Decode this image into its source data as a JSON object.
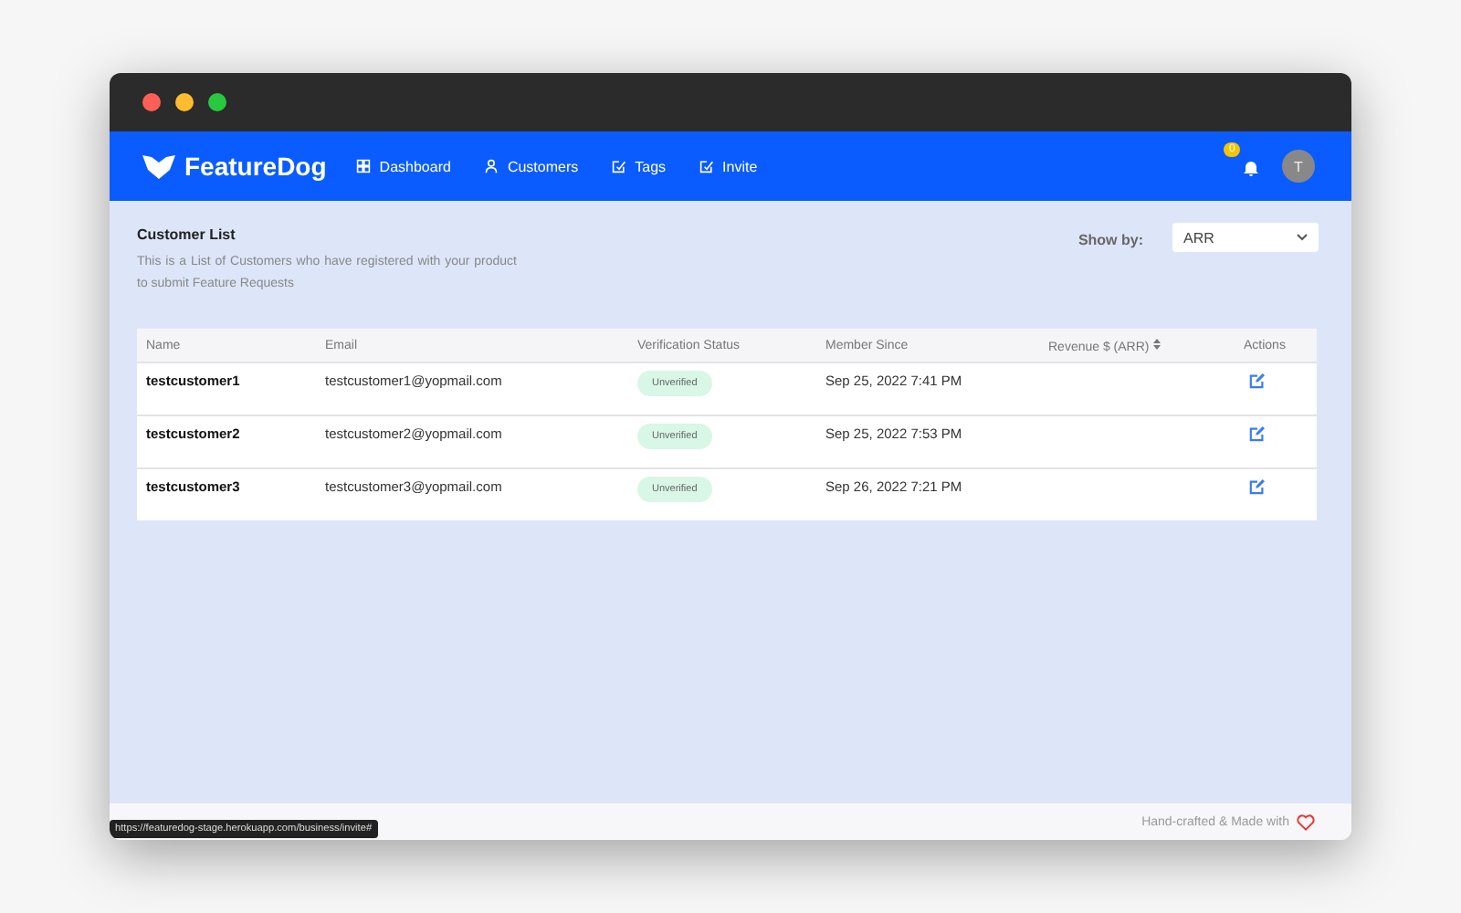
{
  "nav": {
    "brand": "FeatureDog",
    "items": [
      {
        "label": "Dashboard"
      },
      {
        "label": "Customers"
      },
      {
        "label": "Tags"
      },
      {
        "label": "Invite"
      }
    ],
    "notification_count": "0",
    "avatar": "T"
  },
  "page": {
    "title": "Customer List",
    "description": "This is a List of Customers who have registered with your product to submit Feature Requests",
    "show_by": {
      "label": "Show by:",
      "value": "ARR"
    }
  },
  "table": {
    "columns": [
      "Name",
      "Email",
      "Verification Status",
      "Member Since",
      "Revenue $ (ARR)",
      "Actions"
    ],
    "rows": [
      {
        "name": "testcustomer1",
        "email": "testcustomer1@yopmail.com",
        "status": "Unverified",
        "member_since": "Sep 25, 2022 7:41 PM"
      },
      {
        "name": "testcustomer2",
        "email": "testcustomer2@yopmail.com",
        "status": "Unverified",
        "member_since": "Sep 25, 2022 7:53 PM"
      },
      {
        "name": "testcustomer3",
        "email": "testcustomer3@yopmail.com",
        "status": "Unverified",
        "member_since": "Sep 26, 2022 7:21 PM"
      }
    ]
  },
  "footer": {
    "made_with": "Hand-crafted & Made with"
  },
  "status_url": "https://featuredog-stage.herokuapp.com/business/invite#"
}
